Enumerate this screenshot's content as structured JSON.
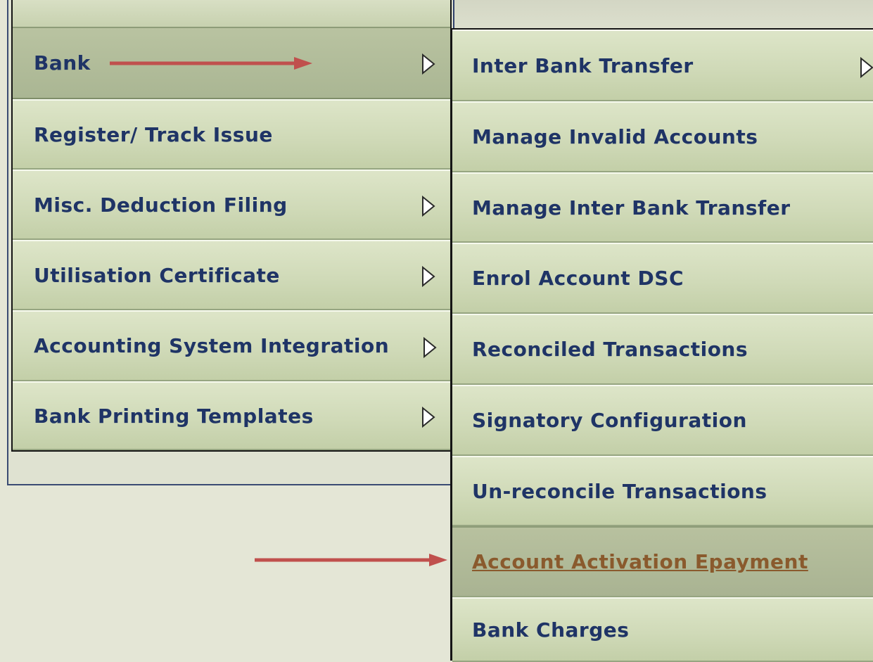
{
  "menu": {
    "items": [
      {
        "label": "Bank",
        "has_submenu": true,
        "active": true
      },
      {
        "label": "Register/ Track Issue",
        "has_submenu": false
      },
      {
        "label": "Misc. Deduction Filing",
        "has_submenu": true
      },
      {
        "label": "Utilisation Certificate",
        "has_submenu": true
      },
      {
        "label": "Accounting System Integration",
        "has_submenu": true
      },
      {
        "label": "Bank Printing Templates",
        "has_submenu": true
      }
    ]
  },
  "submenu": {
    "items": [
      {
        "label": "Inter Bank Transfer",
        "has_submenu": true
      },
      {
        "label": "Manage Invalid Accounts"
      },
      {
        "label": "Manage Inter Bank Transfer"
      },
      {
        "label": "Enrol Account DSC"
      },
      {
        "label": "Reconciled Transactions"
      },
      {
        "label": "Signatory Configuration"
      },
      {
        "label": "Un-reconcile Transactions"
      },
      {
        "label": "Account Activation Epayment",
        "highlighted": true
      },
      {
        "label": "Bank Charges"
      }
    ]
  },
  "colors": {
    "menu_text": "#1f3466",
    "highlight_text": "#8a5a2d",
    "annotation_arrow": "#c0504d"
  }
}
